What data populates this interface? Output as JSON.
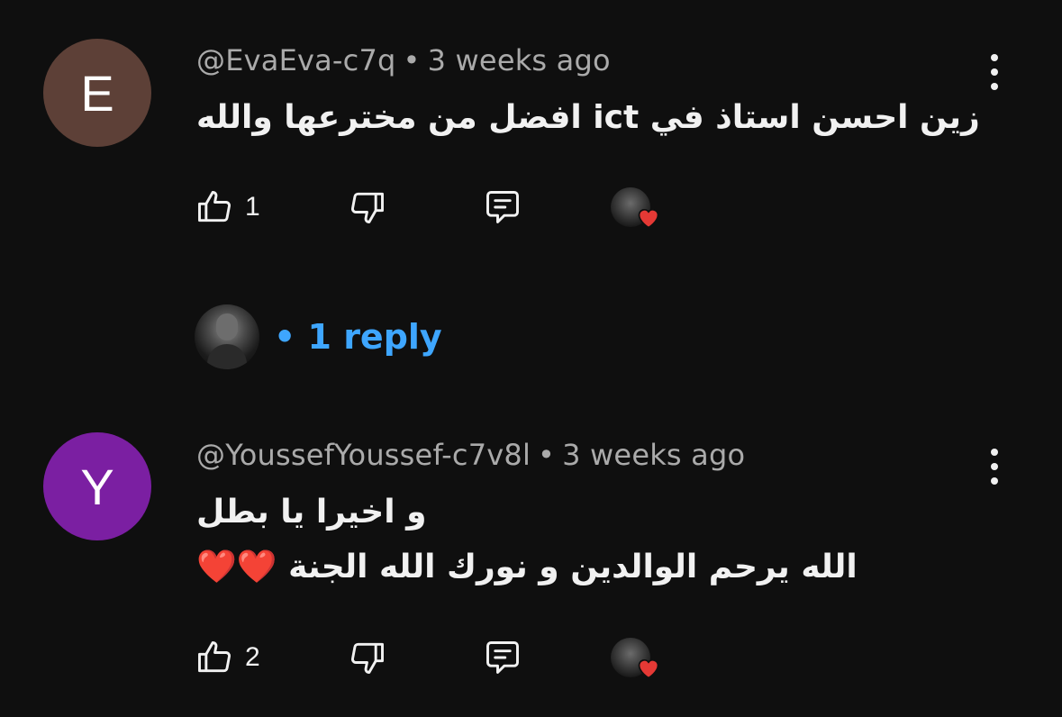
{
  "comments": [
    {
      "avatar_letter": "E",
      "avatar_color": "#5d4037",
      "author": "@EvaEva-c7q",
      "separator": "•",
      "time": "3 weeks ago",
      "lines": [
        "زين احسن استاذ في ict افضل من مخترعها والله"
      ],
      "likes": "1",
      "replies": {
        "count_label": "• 1 reply"
      }
    },
    {
      "avatar_letter": "Y",
      "avatar_color": "#7b1fa2",
      "author": "@YoussefYoussef-c7v8l",
      "separator": "•",
      "time": "3 weeks ago",
      "lines": [
        "و اخيرا يا بطل",
        "الله يرحم الوالدين و نورك الله الجنة ❤️❤️"
      ],
      "likes": "2"
    }
  ],
  "icons": {
    "like": "thumbs-up-icon",
    "dislike": "thumbs-down-icon",
    "reply": "comment-icon",
    "creator_heart": "creator-heart-icon",
    "more": "more-vertical-icon"
  },
  "colors": {
    "background": "#0f0f0f",
    "meta_text": "#aaaaaa",
    "reply_link": "#3ea6ff",
    "heart": "#e53935"
  }
}
